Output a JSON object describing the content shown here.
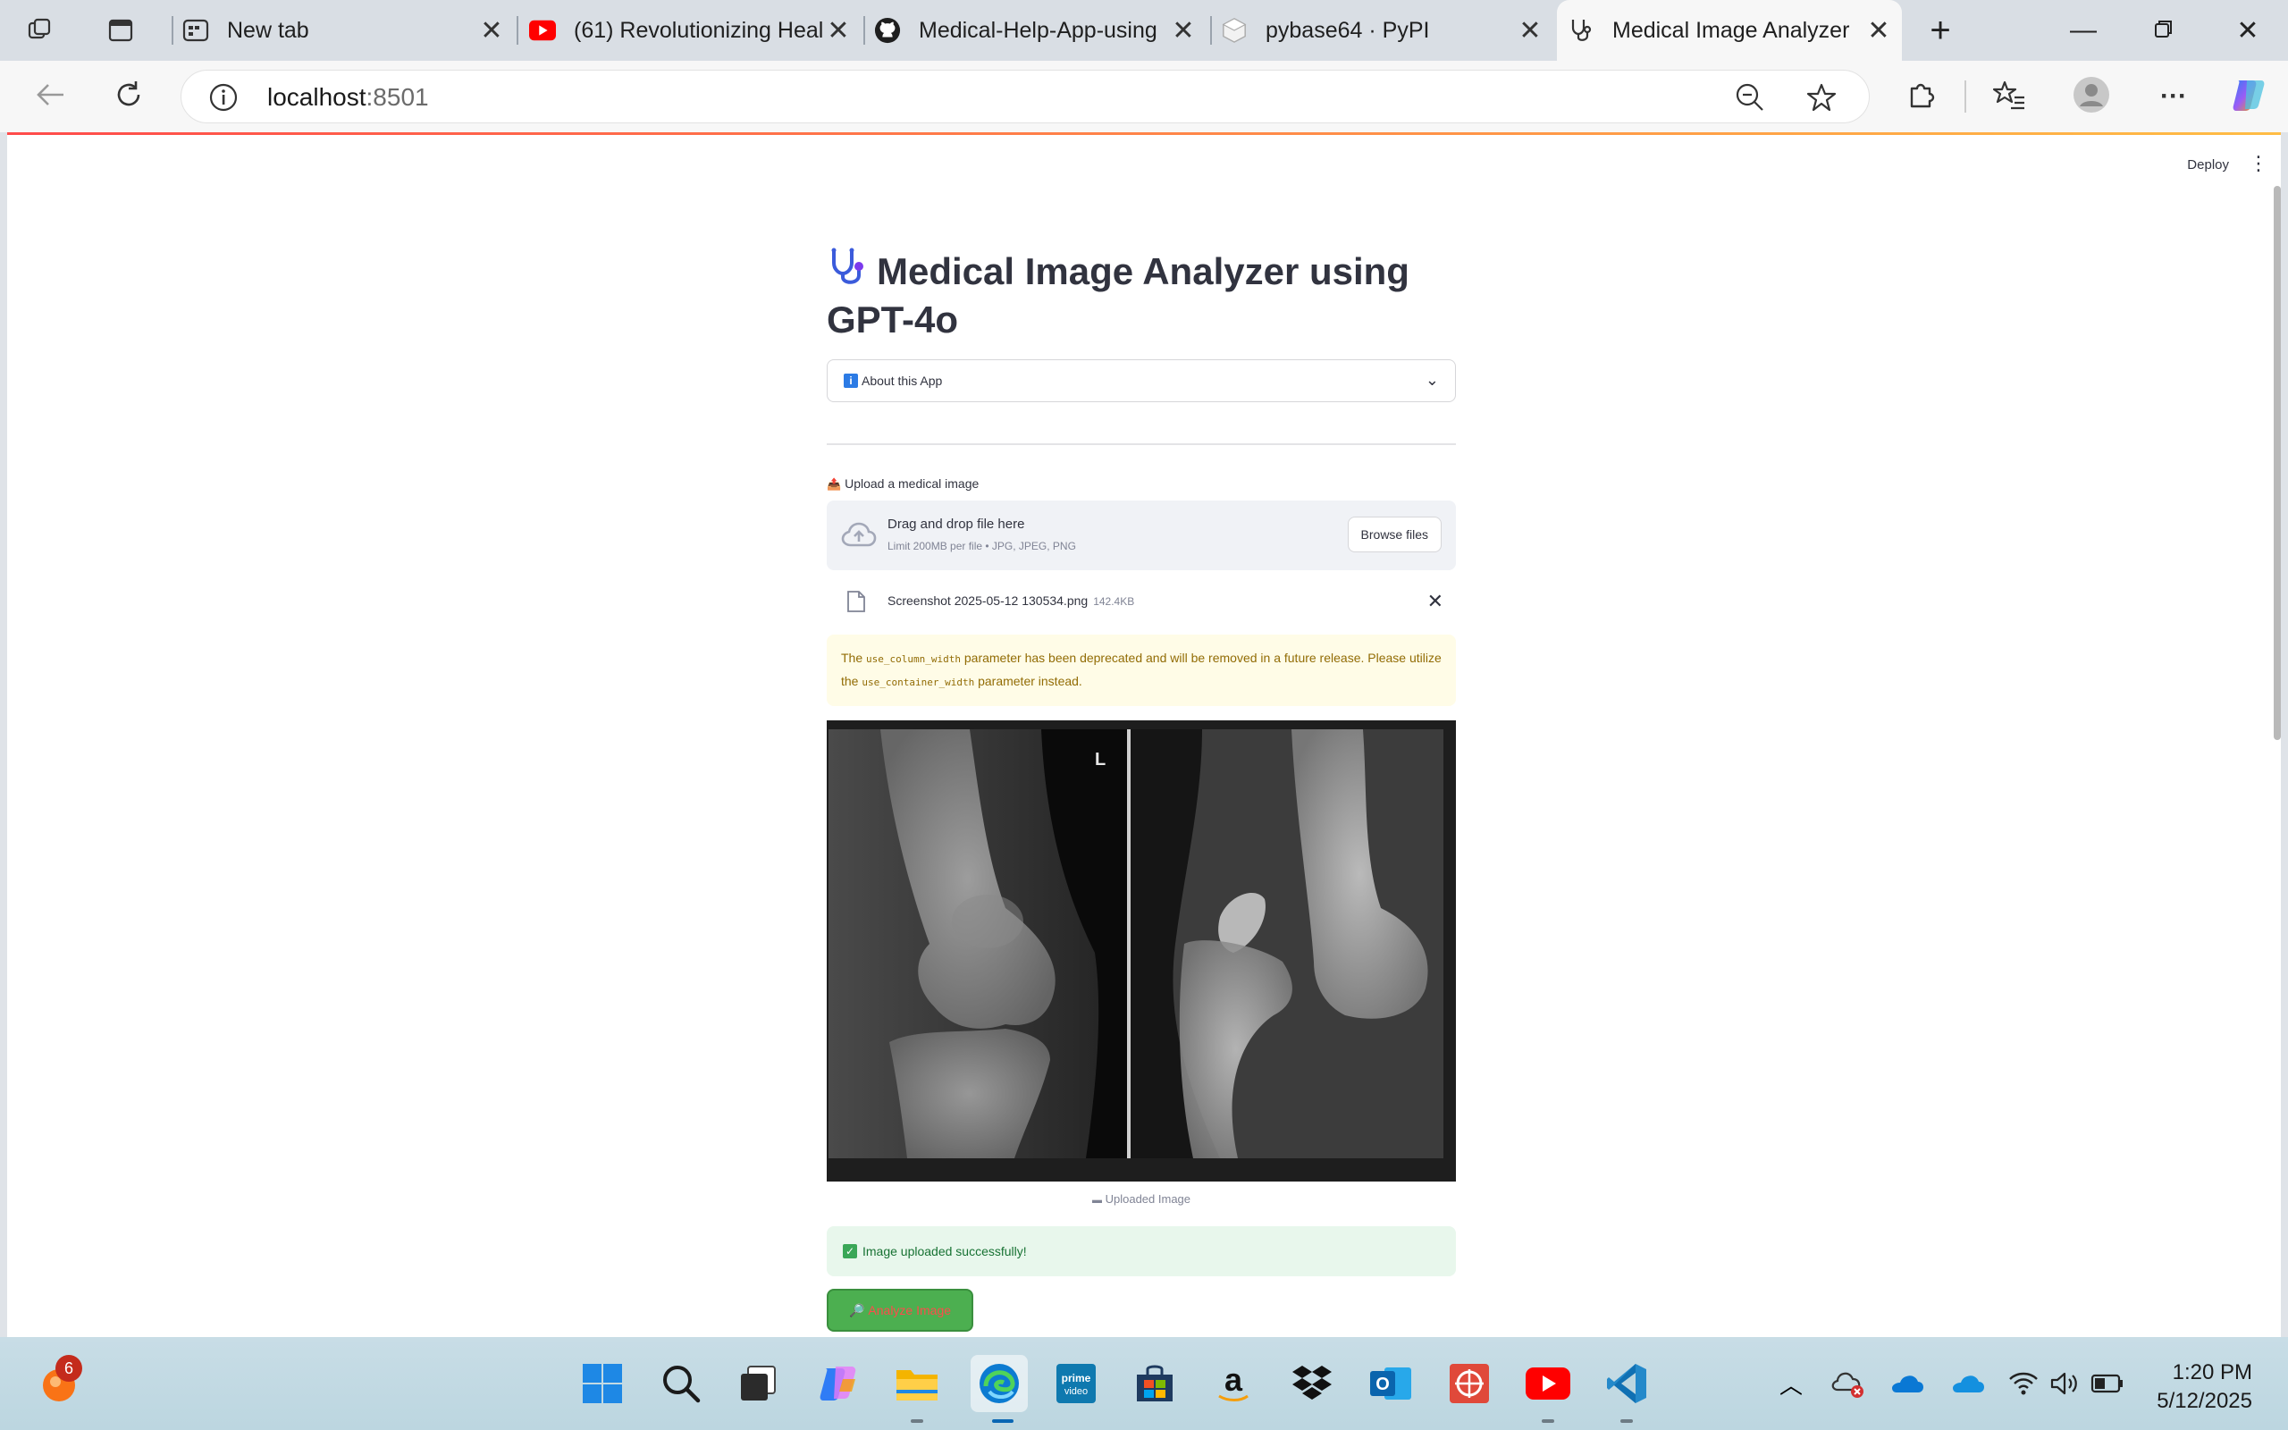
{
  "tabs": [
    {
      "title": "",
      "icon": "workspaces-icon"
    },
    {
      "title": "",
      "icon": "tab-actions-icon"
    },
    {
      "title": "New tab",
      "icon": "new-tab-icon"
    },
    {
      "title": "(61) Revolutionizing Heal",
      "icon": "youtube-icon"
    },
    {
      "title": "Medical-Help-App-using",
      "icon": "github-icon"
    },
    {
      "title": "pybase64 · PyPI",
      "icon": "pypi-icon"
    },
    {
      "title": "Medical Image Analyzer",
      "icon": "stethoscope-icon",
      "active": true
    }
  ],
  "address": {
    "host": "localhost",
    "port": ":8501"
  },
  "page": {
    "deploy_label": "Deploy",
    "title_line": "Medical Image Analyzer using GPT-4o",
    "expander_label": "About this App",
    "uploader": {
      "label": "Upload a medical image",
      "drop_main": "Drag and drop file here",
      "drop_sub": "Limit 200MB per file • JPG, JPEG, PNG",
      "browse_label": "Browse files"
    },
    "file": {
      "name": "Screenshot 2025-05-12 130534.png",
      "size": "142.4KB"
    },
    "warning": {
      "part1": "The ",
      "code1": "use_column_width",
      "part2": " parameter has been deprecated and will be removed in a future release. Please utilize the ",
      "code2": "use_container_width",
      "part3": " parameter instead."
    },
    "xray_marker": "L",
    "caption": "Uploaded Image",
    "success_text": "Image uploaded successfully!",
    "analyze_label": "Analyze Image"
  },
  "taskbar": {
    "notification_count": "6",
    "apps": [
      "start-icon",
      "search-icon",
      "task-view-icon",
      "copilot-icon",
      "file-explorer-icon",
      "edge-icon",
      "prime-video-icon",
      "store-icon",
      "amazon-icon",
      "dropbox-icon",
      "outlook-icon",
      "app-icon",
      "youtube-icon",
      "vscode-icon"
    ],
    "time": "1:20 PM",
    "date": "5/12/2025"
  },
  "colors": {
    "accent_red": "#ff4b4b",
    "success_green": "#4caf50",
    "warning_bg": "#fffce7"
  }
}
